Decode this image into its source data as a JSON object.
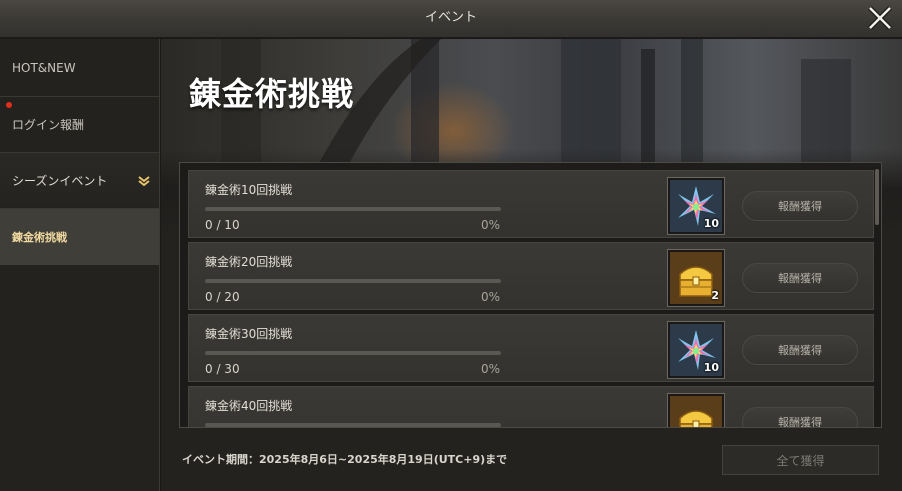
{
  "window": {
    "title": "イベント"
  },
  "sidebar": {
    "items": [
      {
        "label": "HOT&NEW"
      },
      {
        "label": "ログイン報酬",
        "notification": true
      },
      {
        "label": "シーズンイベント",
        "expandable": true
      },
      {
        "label": "錬金術挑戦",
        "selected": true
      }
    ]
  },
  "event": {
    "title": "錬金術挑戦",
    "missions": [
      {
        "name": "錬金術10回挑戦",
        "progress": "0 / 10",
        "percent": "0%",
        "fraction": 0,
        "reward_icon": "rainbow-crystal-icon",
        "reward_qty": "10",
        "button": "報酬獲得"
      },
      {
        "name": "錬金術20回挑戦",
        "progress": "0 / 20",
        "percent": "0%",
        "fraction": 0,
        "reward_icon": "gold-chest-icon",
        "reward_qty": "2",
        "button": "報酬獲得"
      },
      {
        "name": "錬金術30回挑戦",
        "progress": "0 / 30",
        "percent": "0%",
        "fraction": 0,
        "reward_icon": "rainbow-crystal-icon",
        "reward_qty": "10",
        "button": "報酬獲得"
      },
      {
        "name": "錬金術40回挑戦",
        "progress": "",
        "percent": "",
        "fraction": 0,
        "reward_icon": "gold-chest-icon",
        "reward_qty": "",
        "button": "報酬獲得"
      }
    ],
    "period": "イベント期間：2025年8月6日~2025年8月19日(UTC+9)まで",
    "claim_all": "全て獲得"
  },
  "colors": {
    "accent_gold": "#c9a24a",
    "notification_red": "#e0301c",
    "selected_text": "#f0d9a0"
  }
}
